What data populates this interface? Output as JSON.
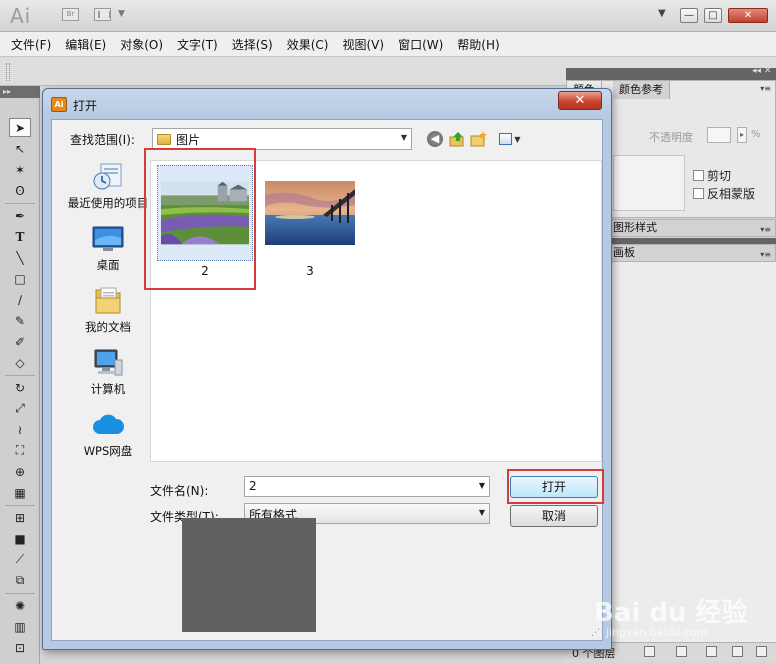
{
  "app": {
    "logo": "Ai",
    "bridge_label": "Br"
  },
  "menubar": {
    "items": [
      "文件(F)",
      "编辑(E)",
      "对象(O)",
      "文字(T)",
      "选择(S)",
      "效果(C)",
      "视图(V)",
      "窗口(W)",
      "帮助(H)"
    ]
  },
  "panels": {
    "color_tab": "颜色",
    "color_guide_tab": "颜色参考",
    "opacity_label": "不透明度",
    "opacity_unit": "%",
    "clip_label": "剪切",
    "invert_mask_label": "反相蒙版",
    "graphic_styles_tab": "图形样式",
    "layers_tab": "画板",
    "layers_count": "0 个图层"
  },
  "dialog": {
    "icon_text": "Ai",
    "title": "打开",
    "close_symbol": "✕",
    "look_in_label": "查找范围(I):",
    "look_in_value": "图片",
    "places": [
      {
        "label": "最近使用的项目",
        "icon": "recent-items-icon"
      },
      {
        "label": "桌面",
        "icon": "desktop-icon"
      },
      {
        "label": "我的文档",
        "icon": "my-documents-icon"
      },
      {
        "label": "计算机",
        "icon": "computer-icon"
      },
      {
        "label": "WPS网盘",
        "icon": "wps-cloud-icon"
      }
    ],
    "files": [
      {
        "name": "2",
        "selected": true
      },
      {
        "name": "3",
        "selected": false
      }
    ],
    "filename_label": "文件名(N):",
    "filename_value": "2",
    "filetype_label": "文件类型(T):",
    "filetype_value": "所有格式",
    "open_button": "打开",
    "cancel_button": "取消"
  },
  "watermark": {
    "brand": "Bai du 经验",
    "url": "jingyan.baidu.com"
  },
  "colors": {
    "highlight_red": "#d83b3b",
    "dialog_frame": "#b6c9e2",
    "preview_gray": "#616161"
  }
}
